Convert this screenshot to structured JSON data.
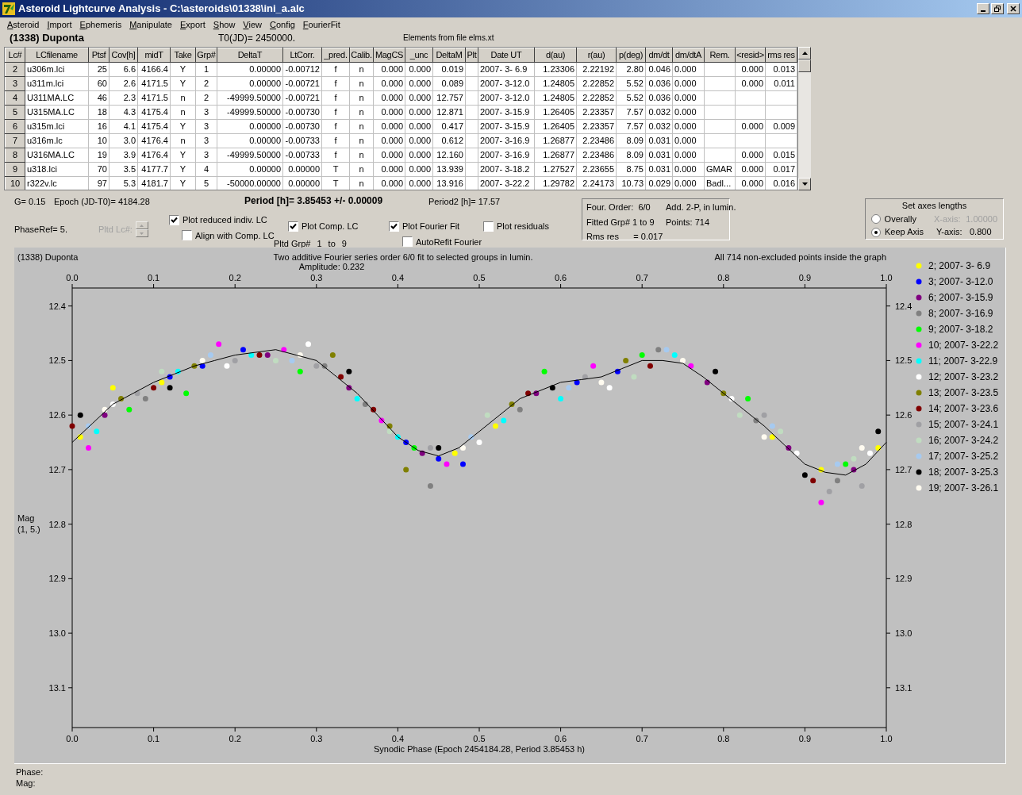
{
  "window": {
    "title": "Asteroid Lightcurve Analysis - C:\\asteroids\\01338\\ini_a.alc"
  },
  "menu": [
    "Asteroid",
    "Import",
    "Ephemeris",
    "Manipulate",
    "Export",
    "Show",
    "View",
    "Config",
    "FourierFit"
  ],
  "header": {
    "object": "(1338) Duponta",
    "t0": "T0(JD)= 2450000.",
    "elements": "Elements from file elms.xt"
  },
  "table": {
    "columns": [
      "Lc#",
      "LCfilename",
      "Ptsf",
      "Cov[h]",
      "midT",
      "Take",
      "Grp#",
      "DeltaT",
      "LtCorr.",
      "_pred.",
      "Calib.",
      "MagCS",
      "_unc",
      "DeltaM",
      "Plt",
      "Date UT",
      "d(au)",
      "r(au)",
      "p(deg)",
      "dm/dt",
      "dm/dtA",
      "Rem.",
      "<resid>",
      "rms res"
    ],
    "rows": [
      [
        "2",
        "u306m.lci",
        "25",
        "6.6",
        "4166.4",
        "Y",
        "1",
        "0.00000",
        "-0.00712",
        "f",
        "n",
        "0.000",
        "0.000",
        "0.019",
        null,
        "2007- 3- 6.9",
        "1.23306",
        "2.22192",
        "2.80",
        "0.046",
        "0.000",
        null,
        "0.000",
        "0.013"
      ],
      [
        "3",
        "u311m.lci",
        "60",
        "2.6",
        "4171.5",
        "Y",
        "2",
        "0.00000",
        "-0.00721",
        "f",
        "n",
        "0.000",
        "0.000",
        "0.089",
        null,
        "2007- 3-12.0",
        "1.24805",
        "2.22852",
        "5.52",
        "0.036",
        "0.000",
        null,
        "0.000",
        "0.011"
      ],
      [
        "4",
        "U311MA.LC",
        "46",
        "2.3",
        "4171.5",
        "n",
        "2",
        "-49999.50000",
        "-0.00721",
        "f",
        "n",
        "0.000",
        "0.000",
        "12.757",
        null,
        "2007- 3-12.0",
        "1.24805",
        "2.22852",
        "5.52",
        "0.036",
        "0.000",
        null,
        null,
        null
      ],
      [
        "5",
        "U315MA.LC",
        "18",
        "4.3",
        "4175.4",
        "n",
        "3",
        "-49999.50000",
        "-0.00730",
        "f",
        "n",
        "0.000",
        "0.000",
        "12.871",
        null,
        "2007- 3-15.9",
        "1.26405",
        "2.23357",
        "7.57",
        "0.032",
        "0.000",
        null,
        null,
        null
      ],
      [
        "6",
        "u315m.lci",
        "16",
        "4.1",
        "4175.4",
        "Y",
        "3",
        "0.00000",
        "-0.00730",
        "f",
        "n",
        "0.000",
        "0.000",
        "0.417",
        null,
        "2007- 3-15.9",
        "1.26405",
        "2.23357",
        "7.57",
        "0.032",
        "0.000",
        null,
        "0.000",
        "0.009"
      ],
      [
        "7",
        "u316m.lc",
        "10",
        "3.0",
        "4176.4",
        "n",
        "3",
        "0.00000",
        "-0.00733",
        "f",
        "n",
        "0.000",
        "0.000",
        "0.612",
        null,
        "2007- 3-16.9",
        "1.26877",
        "2.23486",
        "8.09",
        "0.031",
        "0.000",
        null,
        null,
        null
      ],
      [
        "8",
        "U316MA.LC",
        "19",
        "3.9",
        "4176.4",
        "Y",
        "3",
        "-49999.50000",
        "-0.00733",
        "f",
        "n",
        "0.000",
        "0.000",
        "12.160",
        null,
        "2007- 3-16.9",
        "1.26877",
        "2.23486",
        "8.09",
        "0.031",
        "0.000",
        null,
        "0.000",
        "0.015"
      ],
      [
        "9",
        "u318.lci",
        "70",
        "3.5",
        "4177.7",
        "Y",
        "4",
        "0.00000",
        "0.00000",
        "T",
        "n",
        "0.000",
        "0.000",
        "13.939",
        null,
        "2007- 3-18.2",
        "1.27527",
        "2.23655",
        "8.75",
        "0.031",
        "0.000",
        "GMAR",
        "0.000",
        "0.017"
      ],
      [
        "10",
        "r322v.lc",
        "97",
        "5.3",
        "4181.7",
        "Y",
        "5",
        "-50000.00000",
        "0.00000",
        "T",
        "n",
        "0.000",
        "0.000",
        "13.916",
        null,
        "2007- 3-22.2",
        "1.29782",
        "2.24173",
        "10.73",
        "0.029",
        "0.000",
        "Badl...",
        "0.000",
        "0.016"
      ]
    ]
  },
  "info": {
    "g": "G= 0.15",
    "epoch": "Epoch (JD-T0)= 4184.28",
    "period": "Period [h]= 3.85453 +/- 0.00009",
    "period2": "Period2 [h]= 17.57",
    "phase_ref": "PhaseRef= 5.",
    "pltd_lc": {
      "label": "Pltd Lc#:",
      "disabled": true
    },
    "pltd_grp": {
      "label": "Pltd Grp#",
      "from": "1",
      "to_label": "to",
      "to": "9"
    }
  },
  "checkboxes": [
    {
      "label": "Plot reduced indiv. LC",
      "checked": true
    },
    {
      "label": "Align with Comp. LC",
      "checked": false
    },
    {
      "label": "Plot Comp. LC",
      "checked": true
    },
    {
      "label": "Plot Fourier Fit",
      "checked": true
    },
    {
      "label": "AutoRefit Fourier",
      "checked": false
    },
    {
      "label": "Plot residuals",
      "checked": false
    }
  ],
  "fit_info": [
    "Four. Order:  6/0",
    "Add. 2-P, in lumin.",
    "Fitted Grp# 1 to 9",
    "Points: 714",
    "Rms res      = 0.017"
  ],
  "axes_lengths": {
    "title": "Set axes lengths",
    "options": [
      {
        "label": "Overally",
        "selected": false
      },
      {
        "label": "Keep Axis",
        "selected": true
      }
    ],
    "x_axis": {
      "label": "X-axis:",
      "value": "1.00000",
      "disabled": true
    },
    "y_axis": {
      "label": "Y-axis:",
      "value": "0.800",
      "disabled": false
    }
  },
  "plot": {
    "object": "(1338) Duponta",
    "title": "Two additive Fourier series order 6/0 fit to selected groups in lumin.",
    "subtitle": "Amplitude: 0.232",
    "note": "All 714 non-excluded points inside the graph",
    "ylabel_unit": "(1, 5.)",
    "chart_data": {
      "type": "scatter",
      "legend": true,
      "xlabel": "Synodic Phase (Epoch 2454184.28, Period 3.85453 h)",
      "ylabel": "Mag",
      "xlim": [
        0,
        1
      ],
      "ylim": [
        13.173,
        12.367
      ],
      "xticks": [
        {
          "value": 0,
          "label": "0.0"
        },
        {
          "value": 0.1,
          "label": "0.1"
        },
        {
          "value": 0.2,
          "label": "0.2"
        },
        {
          "value": 0.3,
          "label": "0.3"
        },
        {
          "value": 0.4,
          "label": "0.4"
        },
        {
          "value": 0.5,
          "label": "0.5"
        },
        {
          "value": 0.6,
          "label": "0.6"
        },
        {
          "value": 0.7,
          "label": "0.7"
        },
        {
          "value": 0.8,
          "label": "0.8"
        },
        {
          "value": 0.9,
          "label": "0.9"
        },
        {
          "value": 1,
          "label": "1.0"
        }
      ],
      "yticks": [
        {
          "value": 12.4,
          "label": "12.4"
        },
        {
          "value": 12.5,
          "label": "12.5"
        },
        {
          "value": 12.6,
          "label": "12.6"
        },
        {
          "value": 12.7,
          "label": "12.7"
        },
        {
          "value": 12.8,
          "label": "12.8"
        },
        {
          "value": 12.9,
          "label": "12.9"
        },
        {
          "value": 13.0,
          "label": "13.0"
        },
        {
          "value": 13.1,
          "label": "13.1"
        }
      ],
      "series": [
        {
          "name": "2; 2007- 3- 6.9",
          "color": "#ffff00",
          "x": [
            0.01,
            0.05,
            0.11,
            0.47,
            0.52,
            0.86,
            0.92,
            0.99
          ],
          "values": [
            12.64,
            12.55,
            12.54,
            12.67,
            12.62,
            12.64,
            12.7,
            12.66
          ]
        },
        {
          "name": "3; 2007- 3-12.0",
          "color": "#0000ff",
          "x": [
            0.12,
            0.16,
            0.21,
            0.41,
            0.45,
            0.48,
            0.62,
            0.67
          ],
          "values": [
            12.53,
            12.51,
            12.48,
            12.65,
            12.68,
            12.69,
            12.54,
            12.52
          ]
        },
        {
          "name": "6; 2007- 3-15.9",
          "color": "#800080",
          "x": [
            0.04,
            0.24,
            0.34,
            0.43,
            0.57,
            0.78,
            0.88,
            0.96
          ],
          "values": [
            12.6,
            12.49,
            12.55,
            12.67,
            12.56,
            12.54,
            12.66,
            12.7
          ]
        },
        {
          "name": "8; 2007- 3-16.9",
          "color": "#808080",
          "x": [
            0.09,
            0.31,
            0.36,
            0.44,
            0.55,
            0.72,
            0.84,
            0.94
          ],
          "values": [
            12.57,
            12.51,
            12.58,
            12.73,
            12.59,
            12.48,
            12.61,
            12.72
          ]
        },
        {
          "name": "9; 2007- 3-18.2",
          "color": "#00ff00",
          "x": [
            0.07,
            0.14,
            0.28,
            0.42,
            0.58,
            0.7,
            0.83,
            0.95
          ],
          "values": [
            12.59,
            12.56,
            12.52,
            12.66,
            12.52,
            12.49,
            12.57,
            12.69
          ]
        },
        {
          "name": "10; 2007- 3-22.2",
          "color": "#ff00ff",
          "x": [
            0.02,
            0.18,
            0.26,
            0.38,
            0.46,
            0.64,
            0.76,
            0.92
          ],
          "values": [
            12.66,
            12.47,
            12.48,
            12.61,
            12.69,
            12.51,
            12.51,
            12.76
          ]
        },
        {
          "name": "11; 2007- 3-22.9",
          "color": "#00ffff",
          "x": [
            0.03,
            0.13,
            0.22,
            0.35,
            0.4,
            0.53,
            0.6,
            0.74
          ],
          "values": [
            12.63,
            12.52,
            12.49,
            12.57,
            12.64,
            12.61,
            12.57,
            12.49
          ]
        },
        {
          "name": "12; 2007- 3-23.2",
          "color": "#ffffff",
          "x": [
            0.05,
            0.19,
            0.29,
            0.5,
            0.66,
            0.81,
            0.89,
            0.98
          ],
          "values": [
            12.58,
            12.51,
            12.47,
            12.65,
            12.55,
            12.57,
            12.67,
            12.67
          ]
        },
        {
          "name": "13; 2007- 3-23.5",
          "color": "#808000",
          "x": [
            0.06,
            0.15,
            0.32,
            0.39,
            0.41,
            0.54,
            0.68,
            0.8
          ],
          "values": [
            12.57,
            12.51,
            12.49,
            12.62,
            12.7,
            12.58,
            12.5,
            12.56
          ]
        },
        {
          "name": "14; 2007- 3-23.6",
          "color": "#800000",
          "x": [
            0.0,
            0.1,
            0.23,
            0.33,
            0.37,
            0.56,
            0.71,
            0.91
          ],
          "values": [
            12.62,
            12.55,
            12.49,
            12.53,
            12.59,
            12.56,
            12.51,
            12.72
          ]
        },
        {
          "name": "15; 2007- 3-24.1",
          "color": "#a0a0a4",
          "x": [
            0.08,
            0.2,
            0.3,
            0.44,
            0.63,
            0.85,
            0.93,
            0.97
          ],
          "values": [
            12.56,
            12.5,
            12.51,
            12.66,
            12.53,
            12.6,
            12.74,
            12.73
          ]
        },
        {
          "name": "16; 2007- 3-24.2",
          "color": "#c0dcc0",
          "x": [
            0.11,
            0.25,
            0.39,
            0.51,
            0.69,
            0.82,
            0.87,
            0.96
          ],
          "values": [
            12.52,
            12.5,
            12.63,
            12.6,
            12.53,
            12.6,
            12.63,
            12.68
          ]
        },
        {
          "name": "17; 2007- 3-25.2",
          "color": "#a6caf0",
          "x": [
            0.02,
            0.17,
            0.27,
            0.49,
            0.61,
            0.73,
            0.86,
            0.94
          ],
          "values": [
            12.62,
            12.49,
            12.5,
            12.64,
            12.55,
            12.48,
            12.62,
            12.69
          ]
        },
        {
          "name": "18; 2007- 3-25.3",
          "color": "#000000",
          "x": [
            0.01,
            0.12,
            0.34,
            0.45,
            0.59,
            0.79,
            0.9,
            0.99
          ],
          "values": [
            12.6,
            12.55,
            12.52,
            12.66,
            12.55,
            12.52,
            12.71,
            12.63
          ]
        },
        {
          "name": "19; 2007- 3-26.1",
          "color": "#fffbf0",
          "x": [
            0.04,
            0.16,
            0.28,
            0.48,
            0.65,
            0.75,
            0.85,
            0.97
          ],
          "values": [
            12.59,
            12.5,
            12.49,
            12.66,
            12.54,
            12.5,
            12.64,
            12.66
          ]
        },
        {
          "type": "line",
          "color": "#000000",
          "x": [
            0,
            0.025,
            0.05,
            0.075,
            0.1,
            0.125,
            0.15,
            0.175,
            0.2,
            0.225,
            0.25,
            0.275,
            0.3,
            0.325,
            0.35,
            0.375,
            0.4,
            0.425,
            0.45,
            0.475,
            0.5,
            0.525,
            0.55,
            0.575,
            0.6,
            0.625,
            0.65,
            0.675,
            0.7,
            0.725,
            0.75,
            0.775,
            0.8,
            0.825,
            0.85,
            0.875,
            0.9,
            0.925,
            0.95,
            0.975,
            1
          ],
          "values": [
            12.65,
            12.615,
            12.58,
            12.56,
            12.54,
            12.525,
            12.51,
            12.5,
            12.49,
            12.485,
            12.48,
            12.49,
            12.5,
            12.53,
            12.56,
            12.6,
            12.64,
            12.665,
            12.675,
            12.66,
            12.63,
            12.6,
            12.57,
            12.555,
            12.54,
            12.535,
            12.53,
            12.515,
            12.5,
            12.5,
            12.505,
            12.53,
            12.56,
            12.59,
            12.62,
            12.655,
            12.69,
            12.705,
            12.71,
            12.69,
            12.65
          ]
        }
      ]
    }
  },
  "status": [
    "Phase:",
    "Mag:"
  ]
}
